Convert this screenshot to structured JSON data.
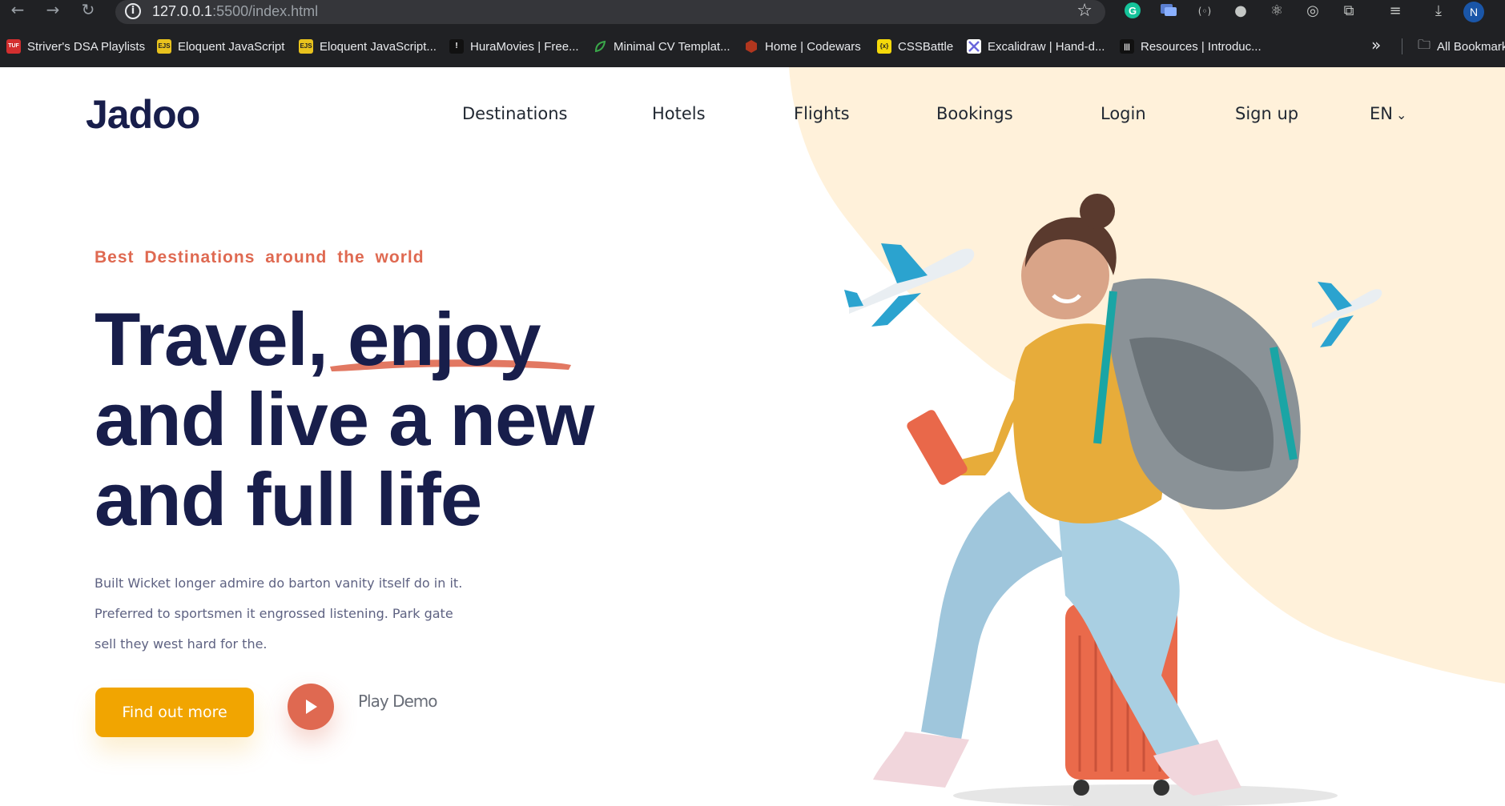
{
  "browser": {
    "url_host": "127.0.0.1",
    "url_rest": ":5500/index.html",
    "back_icon": "arrow-left-icon",
    "forward_icon": "arrow-right-icon",
    "reload_icon": "reload-icon",
    "profile_initial": "N",
    "bookmarks": [
      {
        "label": "Striver's DSA Playlists",
        "icon_text": "TUF",
        "color": "#d32f2f"
      },
      {
        "label": "Eloquent JavaScript",
        "icon_text": "EJS",
        "color": "#e8c21d"
      },
      {
        "label": "Eloquent JavaScript...",
        "icon_text": "EJS",
        "color": "#e8c21d"
      },
      {
        "label": "HuraMovies | Free...",
        "icon_text": "!",
        "color": "#111111"
      },
      {
        "label": "Minimal CV Templat...",
        "icon_text": "",
        "color": "#3aa84a"
      },
      {
        "label": "Home | Codewars",
        "icon_text": "",
        "color": "#b1361e"
      },
      {
        "label": "CSSBattle",
        "icon_text": "{x}",
        "color": "#f5d90a"
      },
      {
        "label": "Excalidraw | Hand-d...",
        "icon_text": "",
        "color": "#6965db"
      },
      {
        "label": "Resources | Introduc...",
        "icon_text": "|||",
        "color": "#111111"
      }
    ],
    "all_bookmarks_label": "All Bookmarks"
  },
  "site": {
    "logo": "Jadoo",
    "nav": [
      "Destinations",
      "Hotels",
      "Flights",
      "Bookings",
      "Login",
      "Sign up"
    ],
    "language": "EN"
  },
  "hero": {
    "tagline": "Best Destinations around the world",
    "headline_line1_a": "Travel, ",
    "headline_line1_b": "enjoy",
    "headline_line2": "and live a new",
    "headline_line3": "and full life",
    "description": [
      "Built Wicket longer admire do barton vanity itself do in it.",
      "Preferred to sportsmen it engrossed listening. Park gate",
      "sell they west hard for the."
    ],
    "cta_label": "Find out more",
    "play_label": "Play Demo"
  },
  "colors": {
    "navy": "#181e4b",
    "accent_orange": "#df6951",
    "cta_yellow": "#f1a501",
    "blob_cream": "#fff1da"
  }
}
